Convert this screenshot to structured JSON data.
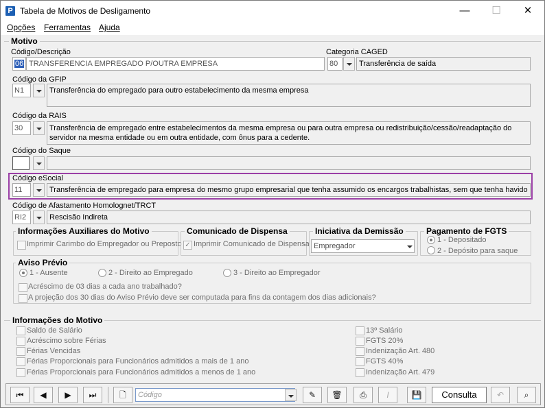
{
  "window": {
    "title": "Tabela de Motivos de Desligamento",
    "minimize": "—",
    "maximize": "☐",
    "close": "✕"
  },
  "menu": [
    "Opções",
    "Ferramentas",
    "Ajuda"
  ],
  "motivo": {
    "section": "Motivo",
    "codigo_label": "Código/Descrição",
    "codigo": "06",
    "descricao": "TRANSFERENCIA EMPREGADO P/OUTRA EMPRESA",
    "caged_label": "Categoria CAGED",
    "caged_code": "80",
    "caged_desc": "Transferência de saída",
    "gfip_label": "Código da GFIP",
    "gfip_code": "N1",
    "gfip_desc": "Transferência do empregado para outro estabelecimento da mesma empresa",
    "rais_label": "Código da RAIS",
    "rais_code": "30",
    "rais_desc": "Transferência de empregado entre estabelecimentos da mesma empresa ou para outra empresa ou redistribuição/cessão/readaptação do servidor na mesma entidade ou em outra entidade, com ônus para a cedente.",
    "saque_label": "Código do Saque",
    "saque_code": "",
    "saque_desc": "",
    "esocial_label": "Código eSocial",
    "esocial_code": "11",
    "esocial_desc": "Transferência de empregado para empresa do mesmo grupo empresarial que tenha assumido os encargos trabalhistas, sem que tenha havido rescisão",
    "afast_label": "Código de Afastamento Homolognet/TRCT",
    "afast_code": "RI2",
    "afast_desc": "Rescisão Indireta"
  },
  "aux": {
    "title": "Informações Auxiliares do Motivo",
    "carimbo": "Imprimir Carimbo do Empregador ou Preposto"
  },
  "comunicado": {
    "title": "Comunicado de Dispensa",
    "imprimir": "Imprimir Comunicado de Dispensa"
  },
  "iniciativa": {
    "title": "Iniciativa da Demissão",
    "value": "Empregador"
  },
  "fgts": {
    "title": "Pagamento de FGTS",
    "opt1": "1 - Depositado",
    "opt2": "2 - Depósito para saque"
  },
  "aviso": {
    "title": "Aviso Prévio",
    "opt1": "1 - Ausente",
    "opt2": "2 - Direito ao Empregado",
    "opt3": "3 - Direito ao Empregador",
    "cb1": "Acréscimo de 03 dias a cada ano trabalhado?",
    "cb2": "A projeção dos 30 dias do Aviso Prévio deve ser computada para fins da contagem dos dias adicionais?"
  },
  "info": {
    "title": "Informações do Motivo",
    "left": [
      "Saldo de Salário",
      "Acréscimo sobre Férias",
      "Férias Vencidas",
      "Férias Proporcionais para Funcionários admitidos a mais de 1 ano",
      "Férias Proporcionais para Funcionários admitidos a menos de 1 ano"
    ],
    "right": [
      "13º Salário",
      "FGTS 20%",
      "Indenização Art. 480",
      "FGTS 40%",
      "Indenização Art. 479"
    ]
  },
  "toolbar": {
    "codigo_placeholder": "Código",
    "consulta": "Consulta"
  }
}
